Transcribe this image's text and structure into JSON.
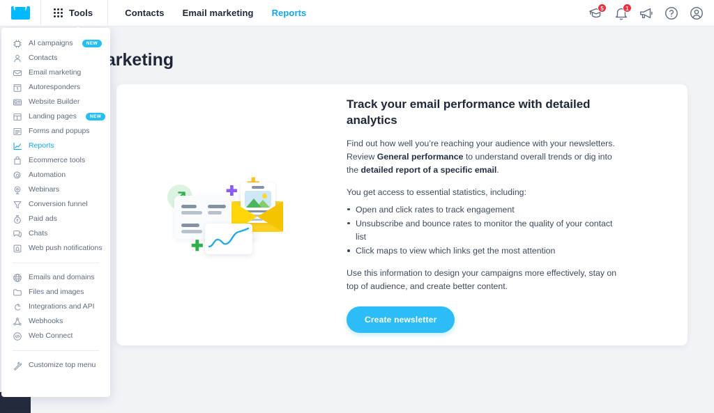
{
  "topbar": {
    "logo_icon": "envelope-logo",
    "tools_label": "Tools",
    "nav": [
      {
        "label": "Contacts",
        "active": false
      },
      {
        "label": "Email marketing",
        "active": false
      },
      {
        "label": "Reports",
        "active": true
      }
    ],
    "right_icons": [
      {
        "name": "graduation-cap-icon",
        "badge": "5"
      },
      {
        "name": "bell-icon",
        "badge": "1"
      },
      {
        "name": "megaphone-icon",
        "badge": ""
      },
      {
        "name": "help-circle-icon",
        "badge": ""
      },
      {
        "name": "user-avatar-icon",
        "badge": ""
      }
    ]
  },
  "page": {
    "title": "Email marketing"
  },
  "flyout": {
    "groups": [
      {
        "items": [
          {
            "label": "AI campaigns",
            "icon": "ai-chip-icon",
            "badge": "NEW",
            "active": false
          },
          {
            "label": "Contacts",
            "icon": "person-icon",
            "badge": "",
            "active": false
          },
          {
            "label": "Email marketing",
            "icon": "envelope-icon",
            "badge": "",
            "active": false
          },
          {
            "label": "Autoresponders",
            "icon": "calendar-icon",
            "badge": "",
            "active": false
          },
          {
            "label": "Website Builder",
            "icon": "browser-icon",
            "badge": "",
            "active": false
          },
          {
            "label": "Landing pages",
            "icon": "layout-icon",
            "badge": "NEW",
            "active": false
          },
          {
            "label": "Forms and popups",
            "icon": "form-icon",
            "badge": "",
            "active": false
          },
          {
            "label": "Reports",
            "icon": "chart-line-icon",
            "badge": "",
            "active": true
          },
          {
            "label": "Ecommerce tools",
            "icon": "bag-icon",
            "badge": "",
            "active": false
          },
          {
            "label": "Automation",
            "icon": "gear-icon",
            "badge": "",
            "active": false
          },
          {
            "label": "Webinars",
            "icon": "webinar-icon",
            "badge": "",
            "active": false
          },
          {
            "label": "Conversion funnel",
            "icon": "funnel-icon",
            "badge": "",
            "active": false
          },
          {
            "label": "Paid ads",
            "icon": "money-bag-icon",
            "badge": "",
            "active": false
          },
          {
            "label": "Chats",
            "icon": "chat-bubble-icon",
            "badge": "",
            "active": false
          },
          {
            "label": "Web push notifications",
            "icon": "push-bell-icon",
            "badge": "",
            "active": false
          }
        ]
      },
      {
        "items": [
          {
            "label": "Emails and domains",
            "icon": "globe-icon",
            "badge": "",
            "active": false
          },
          {
            "label": "Files and images",
            "icon": "folder-icon",
            "badge": "",
            "active": false
          },
          {
            "label": "Integrations and API",
            "icon": "plug-icon",
            "badge": "",
            "active": false
          },
          {
            "label": "Webhooks",
            "icon": "webhook-icon",
            "badge": "",
            "active": false
          },
          {
            "label": "Web Connect",
            "icon": "code-circle-icon",
            "badge": "",
            "active": false
          }
        ]
      },
      {
        "items": [
          {
            "label": "Customize top menu",
            "icon": "wrench-icon",
            "badge": "",
            "active": false
          }
        ]
      }
    ]
  },
  "card": {
    "heading": "Track your email performance with detailed analytics",
    "para1_a": "Find out how well you’re reaching your audience with your newsletters. Review ",
    "para1_b": "General performance",
    "para1_c": " to understand overall trends or dig into the ",
    "para1_d": "detailed report of a specific email",
    "para1_e": ".",
    "para2": "You get access to essential statistics, including:",
    "bullets": [
      "Open and click rates to track engagement",
      "Unsubscribe and bounce rates to monitor the quality of your contact list",
      "Click maps to view which links get the most attention"
    ],
    "para3": "Use this information to design your campaigns more effectively, stay on top of audience, and create better content.",
    "cta_label": "Create newsletter",
    "illustration": "email-analytics-illustration"
  },
  "colors": {
    "accent": "#16a5f0",
    "cta": "#2cbdf7",
    "badge_red": "#e8323c",
    "new_badge": "#27bdf5",
    "page_bg": "#f2f3f7",
    "text_dark": "#1f2736",
    "text_muted": "#5f6b7e"
  }
}
